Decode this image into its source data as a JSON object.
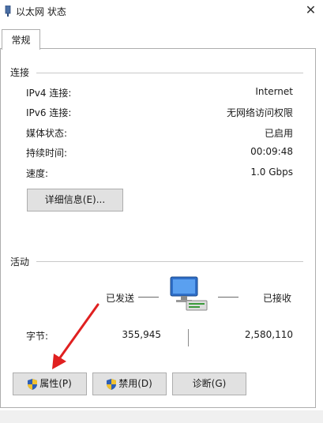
{
  "window": {
    "title": "以太网 状态",
    "close_glyph": "✕"
  },
  "tabs": [
    {
      "label": "常规"
    }
  ],
  "connection": {
    "group_label": "连接",
    "rows": [
      {
        "label": "IPv4 连接:",
        "value": "Internet"
      },
      {
        "label": "IPv6 连接:",
        "value": "无网络访问权限"
      },
      {
        "label": "媒体状态:",
        "value": "已启用"
      },
      {
        "label": "持续时间:",
        "value": "00:09:48"
      },
      {
        "label": "速度:",
        "value": "1.0 Gbps"
      }
    ],
    "details_button": "详细信息(E)..."
  },
  "activity": {
    "group_label": "活动",
    "sent_label": "已发送",
    "received_label": "已接收",
    "bytes_label": "字节:",
    "bytes_sent": "355,945",
    "bytes_received": "2,580,110"
  },
  "buttons": {
    "properties": "属性(P)",
    "disable": "禁用(D)",
    "diagnose": "诊断(G)"
  },
  "icons": {
    "title": "network-adapter-icon",
    "activity": "network-computers-icon",
    "shield": "uac-shield-icon"
  },
  "colors": {
    "annotation_arrow": "#e02020",
    "button_bg": "#e1e1e1"
  }
}
